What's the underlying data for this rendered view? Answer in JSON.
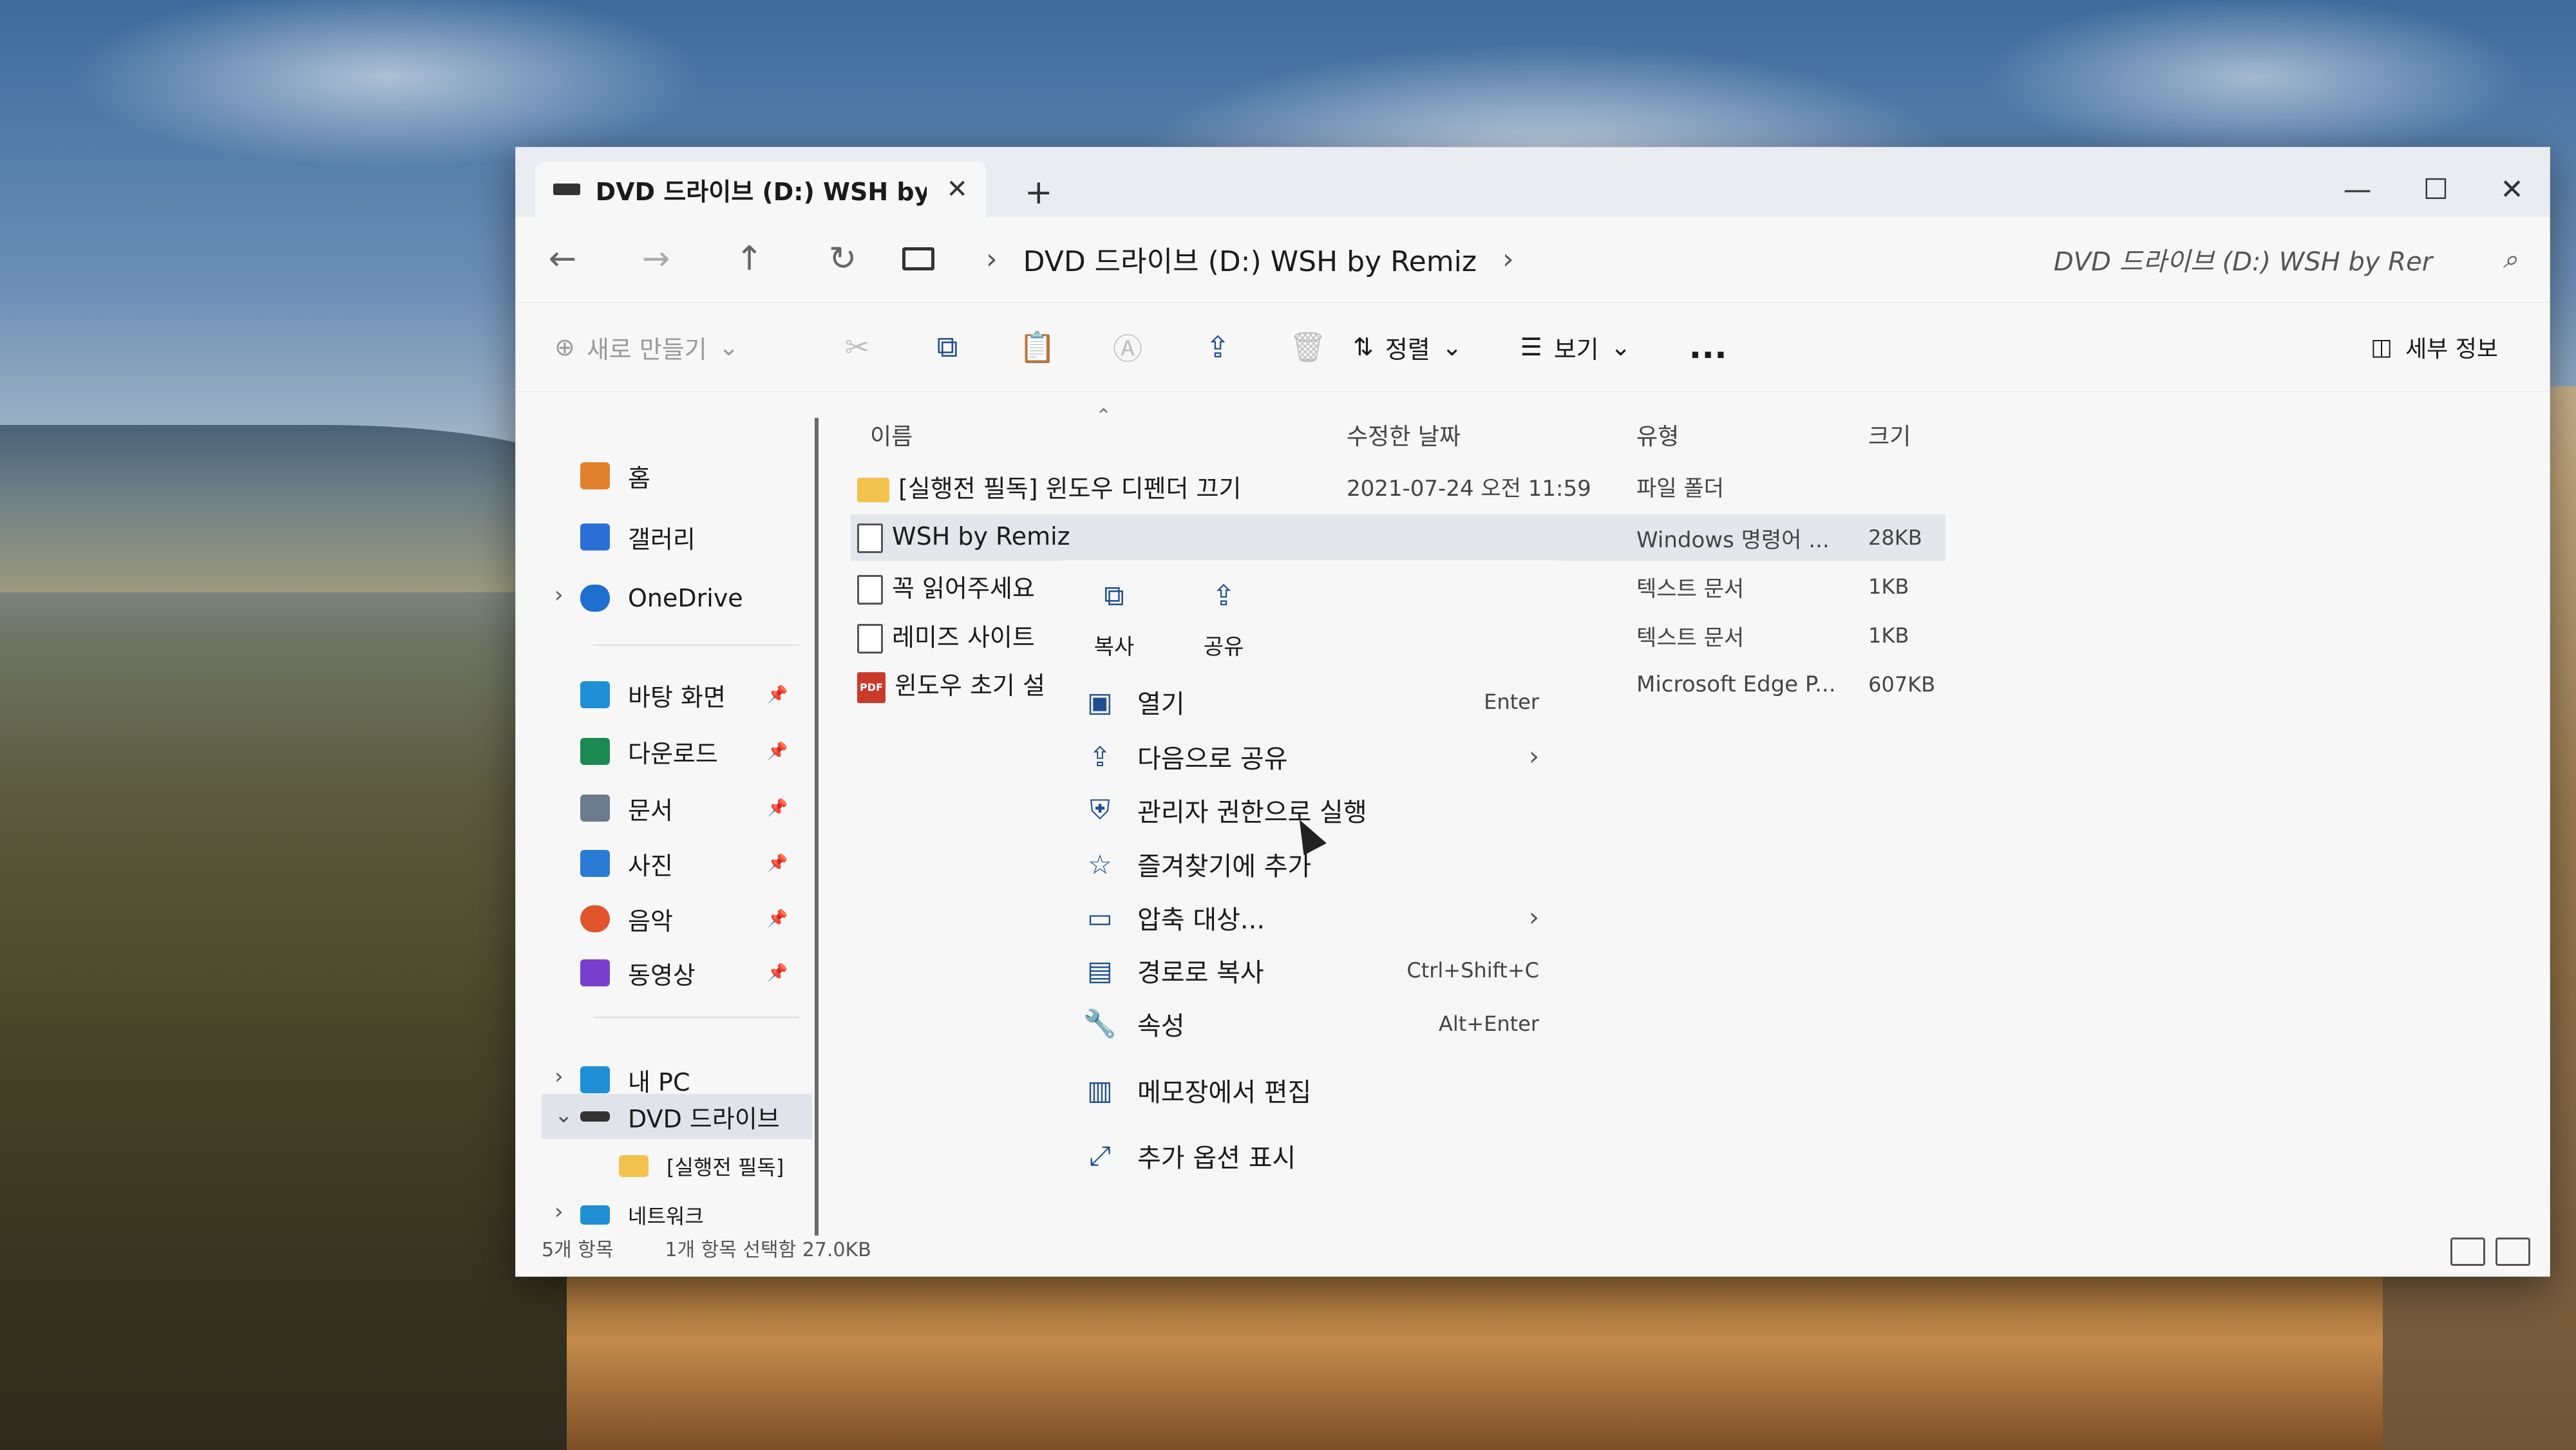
{
  "window": {
    "tab_title": "DVD 드라이브 (D:) WSH by R",
    "new_tab": "+",
    "controls": {
      "minimize": "—",
      "maximize": "☐",
      "close": "✕"
    }
  },
  "address": {
    "back": "←",
    "forward": "→",
    "up": "↑",
    "refresh": "↻",
    "path": "DVD 드라이브 (D:) WSH by Remiz",
    "search_placeholder": "DVD 드라이브 (D:) WSH by Rer"
  },
  "toolbar": {
    "new_label": "새로 만들기",
    "sort_label": "정렬",
    "view_label": "보기",
    "more_label": "...",
    "details_label": "세부 정보"
  },
  "sidebar": {
    "items": [
      {
        "label": "홈",
        "icon": "home-icon",
        "color": "#e0802b"
      },
      {
        "label": "갤러리",
        "icon": "gallery-icon",
        "color": "#2b6fd6"
      },
      {
        "label": "OneDrive",
        "icon": "cloud-icon",
        "color": "#1e6fd0"
      },
      {
        "label": "바탕 화면",
        "icon": "desktop-icon",
        "color": "#1f8fd6"
      },
      {
        "label": "다운로드",
        "icon": "download-icon",
        "color": "#1b8a52"
      },
      {
        "label": "문서",
        "icon": "documents-icon",
        "color": "#6a7b8c"
      },
      {
        "label": "사진",
        "icon": "pictures-icon",
        "color": "#2a7bd6"
      },
      {
        "label": "음악",
        "icon": "music-icon",
        "color": "#e0532b"
      },
      {
        "label": "동영상",
        "icon": "videos-icon",
        "color": "#7a3fd0"
      },
      {
        "label": "내 PC",
        "icon": "pc-icon",
        "color": "#1f8fd6"
      },
      {
        "label": "DVD 드라이브",
        "icon": "dvd-icon",
        "color": "#333333"
      },
      {
        "label": "[실행전 필독]",
        "icon": "folder-icon",
        "color": "#f2c14e"
      },
      {
        "label": "네트워크",
        "icon": "network-icon",
        "color": "#1f8fd6"
      }
    ]
  },
  "files": {
    "headers": {
      "name": "이름",
      "date": "수정한 날짜",
      "type": "유형",
      "size": "크기"
    },
    "rows": [
      {
        "name": "[실행전 필독] 윈도우 디펜더 끄기",
        "date": "2021-07-24 오전 11:59",
        "type": "파일 폴더",
        "size": "",
        "icon": "folder-icon"
      },
      {
        "name": "WSH by Remiz",
        "date": "",
        "type": "Windows 명령어 ...",
        "size": "28KB",
        "icon": "script-icon"
      },
      {
        "name": "꼭 읽어주세요",
        "date": "",
        "type": "텍스트 문서",
        "size": "1KB",
        "icon": "text-file-icon"
      },
      {
        "name": "레미즈 사이트",
        "date": "",
        "type": "텍스트 문서",
        "size": "1KB",
        "icon": "text-file-icon"
      },
      {
        "name": "윈도우 초기 설",
        "date": "",
        "type": "Microsoft Edge P...",
        "size": "607KB",
        "icon": "pdf-icon"
      }
    ]
  },
  "status": {
    "count": "5개 항목",
    "selection": "1개 항목 선택함 27.0KB"
  },
  "context_menu": {
    "quick_actions": [
      {
        "label": "복사",
        "icon": "copy-icon"
      },
      {
        "label": "공유",
        "icon": "share-icon"
      }
    ],
    "items": [
      {
        "label": "열기",
        "shortcut": "Enter",
        "submenu": "",
        "icon": "open-icon"
      },
      {
        "label": "다음으로 공유",
        "shortcut": "",
        "submenu": "›",
        "icon": "share-with-icon"
      },
      {
        "label": "관리자 권한으로 실행",
        "shortcut": "",
        "submenu": "",
        "icon": "shield-icon"
      },
      {
        "label": "즐겨찾기에 추가",
        "shortcut": "",
        "submenu": "",
        "icon": "star-icon"
      },
      {
        "label": "압축 대상...",
        "shortcut": "",
        "submenu": "›",
        "icon": "archive-icon"
      },
      {
        "label": "경로로 복사",
        "shortcut": "Ctrl+Shift+C",
        "submenu": "",
        "icon": "copy-path-icon"
      },
      {
        "label": "속성",
        "shortcut": "Alt+Enter",
        "submenu": "",
        "icon": "wrench-icon"
      },
      {
        "label": "메모장에서 편집",
        "shortcut": "",
        "submenu": "",
        "icon": "notepad-icon"
      },
      {
        "label": "추가 옵션 표시",
        "shortcut": "",
        "submenu": "",
        "icon": "more-options-icon"
      }
    ]
  }
}
